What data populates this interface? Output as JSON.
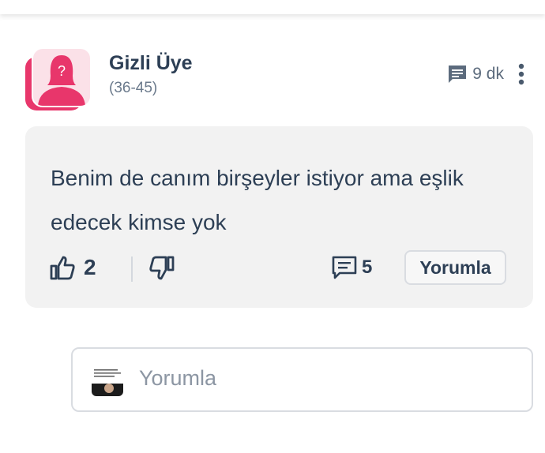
{
  "post": {
    "author_name": "Gizli Üye",
    "author_age": "(36-45)",
    "time": "9 dk",
    "body": "Benim de canım birşeyler istiyor ama eşlik edecek kimse yok",
    "likes": "2",
    "comments": "5",
    "reply_label": "Yorumla"
  },
  "comment_input": {
    "placeholder": "Yorumla"
  },
  "colors": {
    "avatar_pink": "#e8366b",
    "avatar_bg": "#fbe1e8",
    "text_dark": "#2d3f55",
    "card_bg": "#f2f2f2"
  },
  "icons": {
    "meta": "message-icon",
    "more": "more-vertical-icon",
    "like": "thumbs-up-icon",
    "dislike": "thumbs-down-icon",
    "comments": "comment-icon"
  }
}
